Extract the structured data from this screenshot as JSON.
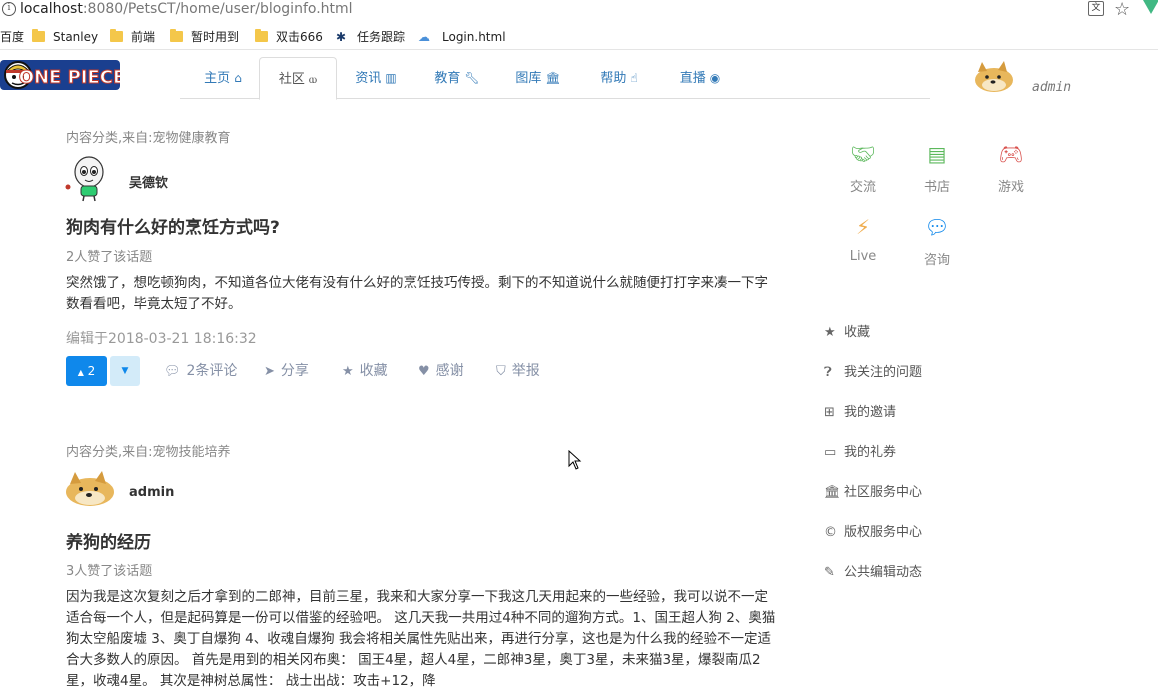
{
  "browser": {
    "url_host": "localhost",
    "url_path": ":8080/PetsCT/home/user/bloginfo.html",
    "bookmarks": [
      "百度",
      "Stanley",
      "前端",
      "暂时用到",
      "双击666",
      "任务跟踪",
      "Login.html"
    ]
  },
  "header": {
    "logo_text": "ONE PIECE",
    "tabs": [
      {
        "label": "主页",
        "icon": "home-icon"
      },
      {
        "label": "社区",
        "icon": "community-icon"
      },
      {
        "label": "资讯",
        "icon": "map-icon"
      },
      {
        "label": "教育",
        "icon": "wrench-icon"
      },
      {
        "label": "图库",
        "icon": "bank-icon"
      },
      {
        "label": "帮助",
        "icon": "hand-icon"
      },
      {
        "label": "直播",
        "icon": "globe-icon"
      }
    ],
    "active_tab": "社区",
    "username": "admin"
  },
  "posts": [
    {
      "category": "内容分类,来自:宠物健康教育",
      "author": "吴德钦",
      "title": "狗肉有什么好的烹饪方式吗?",
      "likes": "2人赞了该话题",
      "body": "突然饿了，想吃顿狗肉，不知道各位大佬有没有什么好的烹饪技巧传授。剩下的不知道说什么就随便打打字来凑一下字数看看吧，毕竟太短了不好。",
      "edited": "编辑于2018-03-21 18:16:32",
      "vote_count": "2",
      "actions": [
        "2条评论",
        "分享",
        "收藏",
        "感谢",
        "举报"
      ]
    },
    {
      "category": "内容分类,来自:宠物技能培养",
      "author": "admin",
      "title": "养狗的经历",
      "likes": "3人赞了该话题",
      "body": "因为我是这次复刻之后才拿到的二郎神，目前三星，我来和大家分享一下我这几天用起来的一些经验，我可以说不一定适合每一个人，但是起码算是一份可以借鉴的经验吧。 这几天我一共用过4种不同的遛狗方式。1、国王超人狗 2、奥猫狗太空船废墟 3、奥丁自爆狗 4、收魂自爆狗 我会将相关属性先贴出来，再进行分享，这也是为什么我的经验不一定适合大多数人的原因。 首先是用到的相关冈布奥： 国王4星，超人4星，二郎神3星，奥丁3星，未来猫3星，爆裂南瓜2星，收魂4星。 其次是神树总属性： 战士出战：攻击+12，降"
    }
  ],
  "sidebar": {
    "apps": [
      {
        "label": "交流",
        "icon": "handshake-icon",
        "color": "#5cb85c"
      },
      {
        "label": "书店",
        "icon": "book-icon",
        "color": "#5cb85c"
      },
      {
        "label": "游戏",
        "icon": "gamepad-icon",
        "color": "#d9534f"
      },
      {
        "label": "Live",
        "icon": "bolt-icon",
        "color": "#f0ad4e"
      },
      {
        "label": "咨询",
        "icon": "chat-icon",
        "color": "#0f88eb"
      }
    ],
    "links": [
      {
        "label": "收藏",
        "icon": "star-icon"
      },
      {
        "label": "我关注的问题",
        "icon": "question-icon"
      },
      {
        "label": "我的邀请",
        "icon": "plus-square-icon"
      },
      {
        "label": "我的礼券",
        "icon": "credit-card-icon"
      },
      {
        "label": "社区服务中心",
        "icon": "bank-icon"
      },
      {
        "label": "版权服务中心",
        "icon": "copyright-icon"
      },
      {
        "label": "公共编辑动态",
        "icon": "edit-icon"
      }
    ]
  }
}
